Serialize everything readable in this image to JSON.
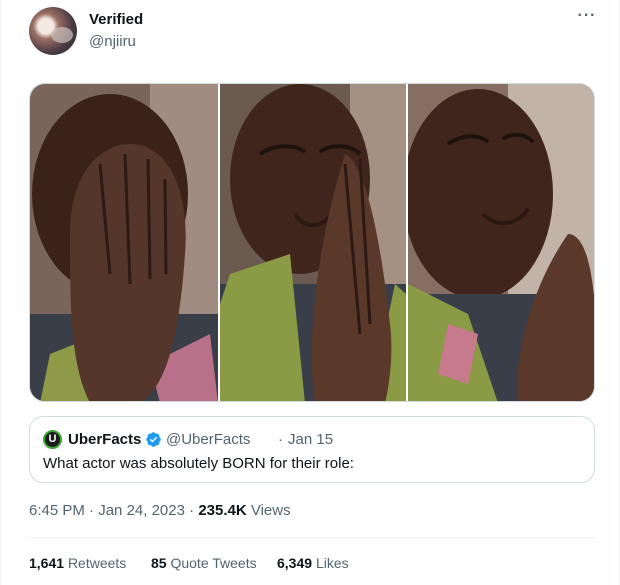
{
  "author": {
    "display_name": "Verified",
    "handle": "@njiiru",
    "avatar": "profile-photo"
  },
  "more_icon": "more-horizontal-icon",
  "media": {
    "panel_count": 3,
    "colors": {
      "backdrop": "#6f5a50",
      "skin": "#4a2e22",
      "shirt_green": "#8a9a45",
      "shirt_pink": "#c77a8c",
      "jacket": "#3b3f4a"
    }
  },
  "quoted_tweet": {
    "logo_letter": "U",
    "name": "UberFacts",
    "verified_icon": "verified-badge-icon",
    "handle": "@UberFacts",
    "separator": "·",
    "date": "Jan 15",
    "text": "What actor was absolutely BORN for their role:"
  },
  "meta": {
    "time": "6:45 PM",
    "separator_1": "·",
    "date": "Jan 24, 2023",
    "separator_2": "·",
    "views_count": "235.4K",
    "views_label": "Views"
  },
  "stats": {
    "retweets_count": "1,641",
    "retweets_label": "Retweets",
    "quotes_count": "85",
    "quotes_label": "Quote Tweets",
    "likes_count": "6,349",
    "likes_label": "Likes"
  },
  "colors": {
    "primary_text": "#0f1419",
    "secondary_text": "#536471",
    "border": "#cfd9de",
    "verified": "#1d9bf0"
  }
}
